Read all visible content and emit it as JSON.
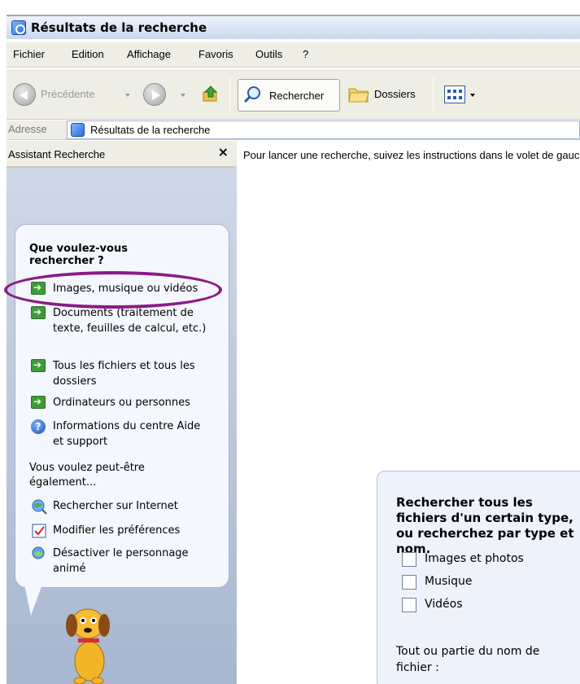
{
  "window": {
    "title": "Résultats de la recherche"
  },
  "menu": {
    "items": [
      "Fichier",
      "Edition",
      "Affichage",
      "Favoris",
      "Outils",
      "?"
    ]
  },
  "toolbar": {
    "back_label": "Précédente",
    "search_label": "Rechercher",
    "folders_label": "Dossiers"
  },
  "address": {
    "label": "Adresse",
    "value": "Résultats de la recherche"
  },
  "left_pane": {
    "title": "Assistant Recherche",
    "close_glyph": "×",
    "question": "Que voulez-vous rechercher ?",
    "options": [
      {
        "label": "Images, musique ou vidéos",
        "icon": "green-arrow-icon"
      },
      {
        "label": "Documents (traitement de texte, feuilles de calcul, etc.)",
        "icon": "green-arrow-icon"
      },
      {
        "label": "Tous les fichiers et tous les dossiers",
        "icon": "green-arrow-icon"
      },
      {
        "label": "Ordinateurs ou personnes",
        "icon": "green-arrow-icon"
      },
      {
        "label": "Informations du centre Aide et support",
        "icon": "help-icon"
      }
    ],
    "also_heading": "Vous voulez peut-être également...",
    "also_items": [
      {
        "label": "Rechercher sur Internet",
        "icon": "internet-search-icon"
      },
      {
        "label": "Modifier les préférences",
        "icon": "preferences-icon"
      },
      {
        "label": "Désactiver le personnage animé",
        "icon": "animated-character-icon"
      }
    ]
  },
  "main": {
    "hint": "Pour lancer une recherche, suivez les instructions dans le volet de gauche."
  },
  "search_panel": {
    "heading": "Rechercher tous les fichiers d'un certain type, ou recherchez par type et nom.",
    "checkboxes": [
      "Images et photos",
      "Musique",
      "Vidéos"
    ],
    "filename_label": "Tout ou partie du nom de fichier :"
  },
  "colors": {
    "highlight": "#8a1b87",
    "pane_background": "#b9c6da",
    "green_arrow": "#3f9b3a"
  }
}
